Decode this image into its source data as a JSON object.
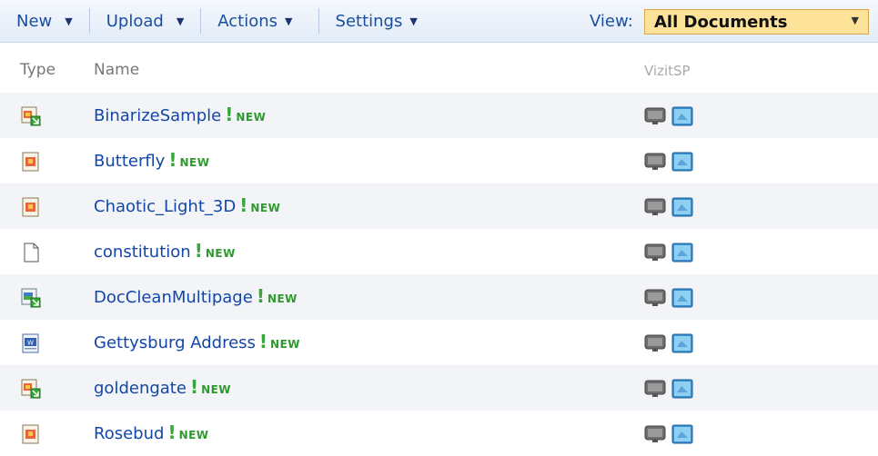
{
  "toolbar": {
    "new_label": "New",
    "upload_label": "Upload",
    "actions_label": "Actions",
    "settings_label": "Settings",
    "view_label": "View:",
    "view_value": "All Documents"
  },
  "columns": {
    "type": "Type",
    "name": "Name",
    "vizit": "VizitSP"
  },
  "new_badge": "NEW",
  "documents": [
    {
      "name": "BinarizeSample",
      "icon": "tiff-image-icon"
    },
    {
      "name": "Butterfly",
      "icon": "image-file-icon"
    },
    {
      "name": "Chaotic_Light_3D",
      "icon": "image-file-icon"
    },
    {
      "name": "constitution",
      "icon": "blank-document-icon"
    },
    {
      "name": "DocCleanMultipage",
      "icon": "tiff-multipage-icon"
    },
    {
      "name": "Gettysburg Address",
      "icon": "word-document-icon"
    },
    {
      "name": "goldengate",
      "icon": "tiff-image-icon"
    },
    {
      "name": "Rosebud",
      "icon": "image-file-icon"
    }
  ],
  "colors": {
    "accent": "#1246a8",
    "new_green": "#2e9a2e",
    "view_bg": "#fde29a"
  }
}
